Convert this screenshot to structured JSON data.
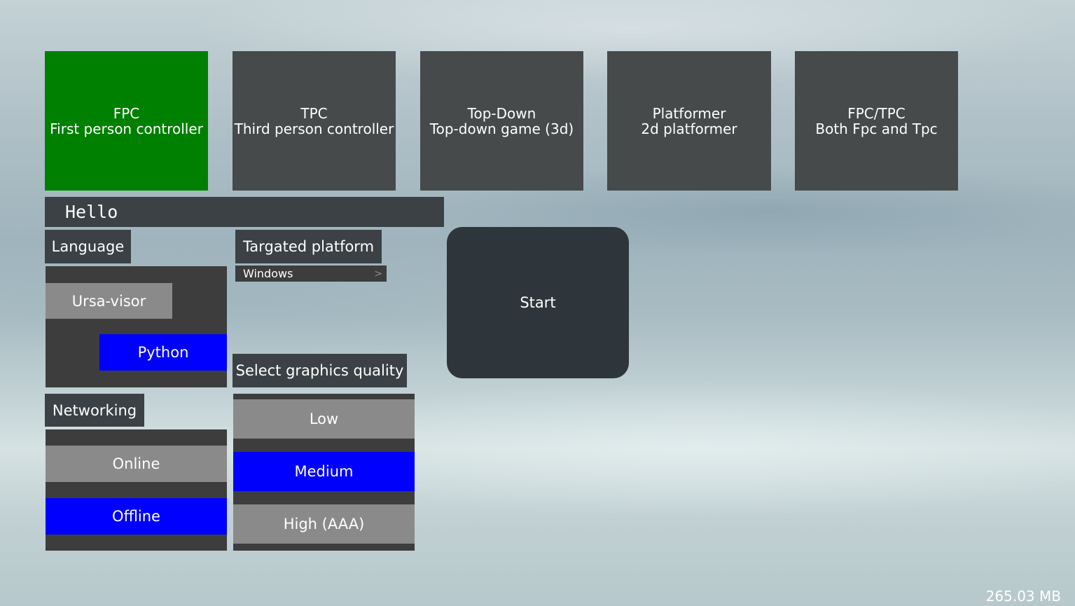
{
  "game_modes": [
    {
      "title": "FPC",
      "subtitle": "First person controller",
      "selected": true
    },
    {
      "title": "TPC",
      "subtitle": "Third person controller",
      "selected": false
    },
    {
      "title": "Top-Down",
      "subtitle": "Top-down game (3d)",
      "selected": false
    },
    {
      "title": "Platformer",
      "subtitle": "2d platformer",
      "selected": false
    },
    {
      "title": "FPC/TPC",
      "subtitle": "Both Fpc and Tpc",
      "selected": false
    }
  ],
  "name_field": {
    "value": "Hello"
  },
  "language": {
    "label": "Language",
    "options": [
      {
        "label": "Ursa-visor",
        "selected": false
      },
      {
        "label": "Python",
        "selected": true
      }
    ]
  },
  "platform": {
    "label": "Targated platform",
    "selected_value": "Windows",
    "arrow": ">"
  },
  "graphics": {
    "label": "Select graphics quality",
    "options": [
      {
        "label": "Low",
        "selected": false
      },
      {
        "label": "Medium",
        "selected": true
      },
      {
        "label": "High (AAA)",
        "selected": false
      }
    ]
  },
  "networking": {
    "label": "Networking",
    "options": [
      {
        "label": "Online",
        "selected": false
      },
      {
        "label": "Offline",
        "selected": true
      }
    ]
  },
  "start_button": {
    "label": "Start"
  },
  "memory_usage": "265.03 MB",
  "colors": {
    "selected_green": "#008000",
    "selected_blue": "#0000ff",
    "unselected_gray": "#8a8a8a",
    "card_dark": "#464a4b"
  }
}
